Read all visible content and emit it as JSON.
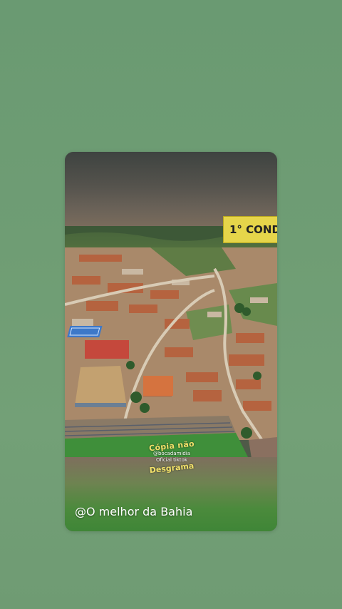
{
  "story": {
    "banner_text": "1° COND",
    "watermark": {
      "line1": "Cópia não",
      "handle": "@bocadamidia",
      "subtitle": "Oficial tiktok",
      "line2": "Desgrama"
    },
    "caption": "@O melhor da Bahia"
  },
  "colors": {
    "background": "#6d9b72",
    "banner": "#e6d54a",
    "watermark_text": "#f1e06a",
    "caption_text": "#ffffff"
  }
}
